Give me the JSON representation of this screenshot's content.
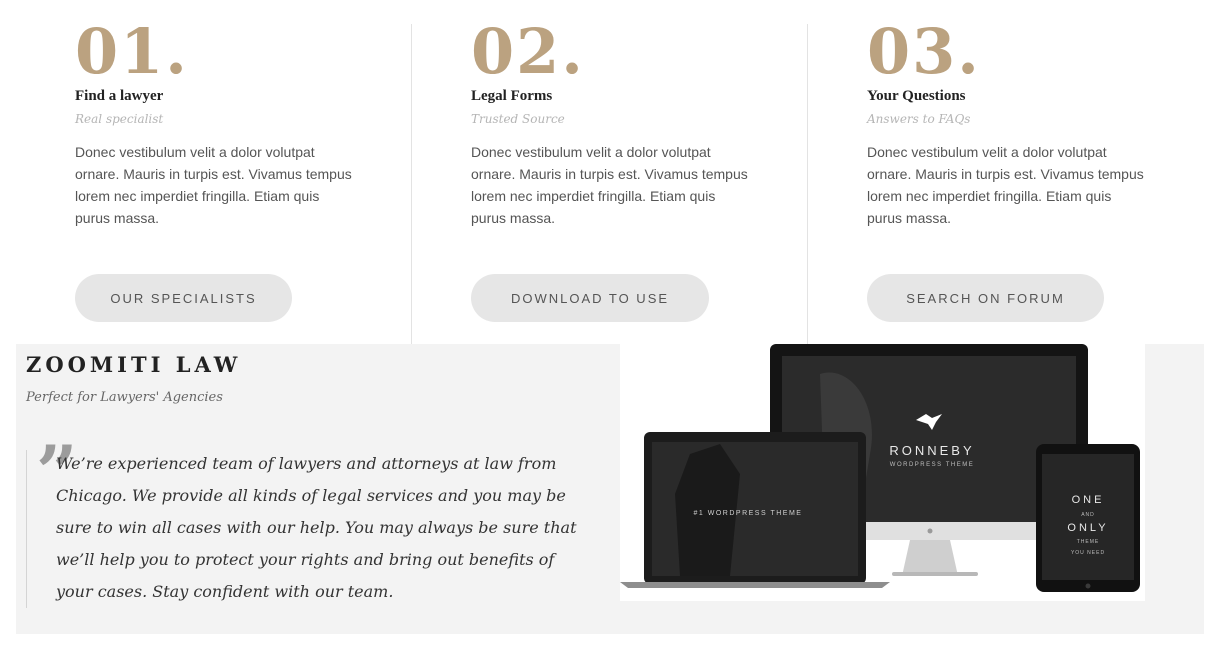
{
  "features": [
    {
      "number": "01.",
      "title": "Find a lawyer",
      "subtitle": "Real specialist",
      "description": "Donec vestibulum velit a dolor volutpat ornare. Mauris in turpis est. Vivamus tempus lorem nec imperdiet fringilla. Etiam quis purus massa.",
      "button_label": "OUR SPECIALISTS"
    },
    {
      "number": "02.",
      "title": "Legal Forms",
      "subtitle": "Trusted Source",
      "description": "Donec vestibulum velit a dolor volutpat ornare. Mauris in turpis est. Vivamus tempus lorem nec imperdiet fringilla. Etiam quis purus massa.",
      "button_label": "DOWNLOAD TO USE"
    },
    {
      "number": "03.",
      "title": "Your Questions",
      "subtitle": "Answers to FAQs",
      "description": "Donec vestibulum velit a dolor volutpat ornare. Mauris in turpis est. Vivamus tempus lorem nec imperdiet fringilla. Etiam quis purus massa.",
      "button_label": "SEARCH ON FORUM"
    }
  ],
  "about": {
    "brand": "ZOOMITI LAW",
    "tagline": "Perfect for Lawyers' Agencies",
    "quote_mark": "”",
    "quote": "We’re experienced team of lawyers and attorneys at law from Chicago. We provide all kinds of legal services and you may be sure to win all cases with our help. You may always be sure that we’ll help you to protect your rights and bring out benefits of your cases. Stay confident with our team."
  },
  "mockup": {
    "desktop_title": "RONNEBY",
    "desktop_subtitle": "WORDPRESS THEME",
    "laptop_text": "#1 WORDPRESS THEME",
    "tablet_line1": "ONE",
    "tablet_line2": "AND",
    "tablet_line3": "ONLY",
    "tablet_line4": "THEME",
    "tablet_line5": "YOU NEED"
  },
  "colors": {
    "accent_gold": "#bba280",
    "button_bg": "#e6e6e6",
    "section_bg": "#f3f3f3"
  }
}
